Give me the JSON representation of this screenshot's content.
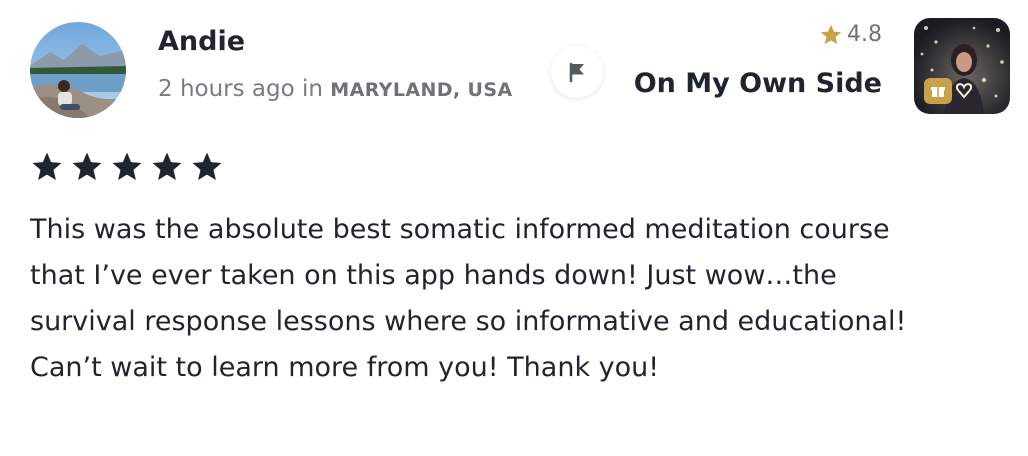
{
  "reviewer": {
    "name": "Andie",
    "time_ago": "2 hours ago in ",
    "location": "MARYLAND, USA",
    "rating_stars": 5
  },
  "course": {
    "title": "On My Own Side",
    "rating": "4.8"
  },
  "review": {
    "text": "This was the absolute best somatic informed meditation course that I’ve ever taken on this app hands down! Just wow…the survival response lessons where so informative and educational! Can’t wait to learn more from you! Thank you!"
  },
  "icons": {
    "flag": "flag-icon",
    "rating_star": "star-icon",
    "badge": "gift-icon"
  },
  "colors": {
    "text": "#1f2430",
    "meta": "#777b82",
    "gold": "#c9a14a",
    "star": "#1f2430"
  }
}
